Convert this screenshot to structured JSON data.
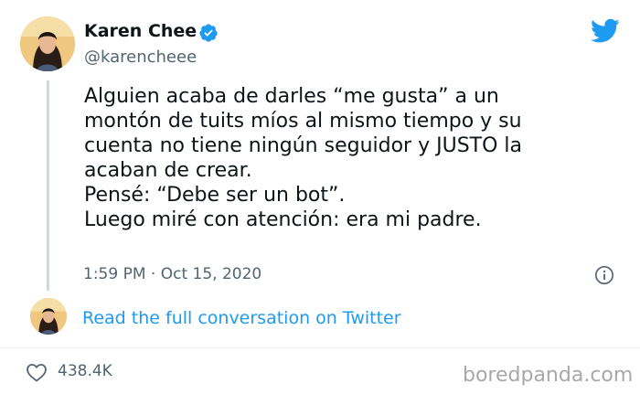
{
  "tweet": {
    "author": {
      "display_name": "Karen Chee",
      "handle": "@karencheee",
      "verified": true
    },
    "lines": [
      "Alguien acaba de darles “me gusta” a un",
      "montón de tuits míos al mismo tiempo y su",
      "cuenta no tiene ningún seguidor y JUSTO la",
      "acaban de crear.",
      "Pensé: “Debe ser un bot”.",
      "Luego miré con atención: era mi padre."
    ],
    "time": "1:59 PM",
    "separator": "·",
    "date": "Oct 15, 2020",
    "conversation_link": "Read the full conversation on Twitter",
    "likes": "438.4K"
  },
  "watermark": "boredpanda.com",
  "icons": {
    "verified": "verified-badge-icon",
    "brand": "twitter-bird-icon",
    "info": "info-icon",
    "like": "heart-icon"
  },
  "colors": {
    "accent": "#1d9bf0",
    "text": "#0f1419",
    "secondary": "#536471",
    "thread_line": "#cfd9de",
    "watermark": "#a8a8a8"
  }
}
